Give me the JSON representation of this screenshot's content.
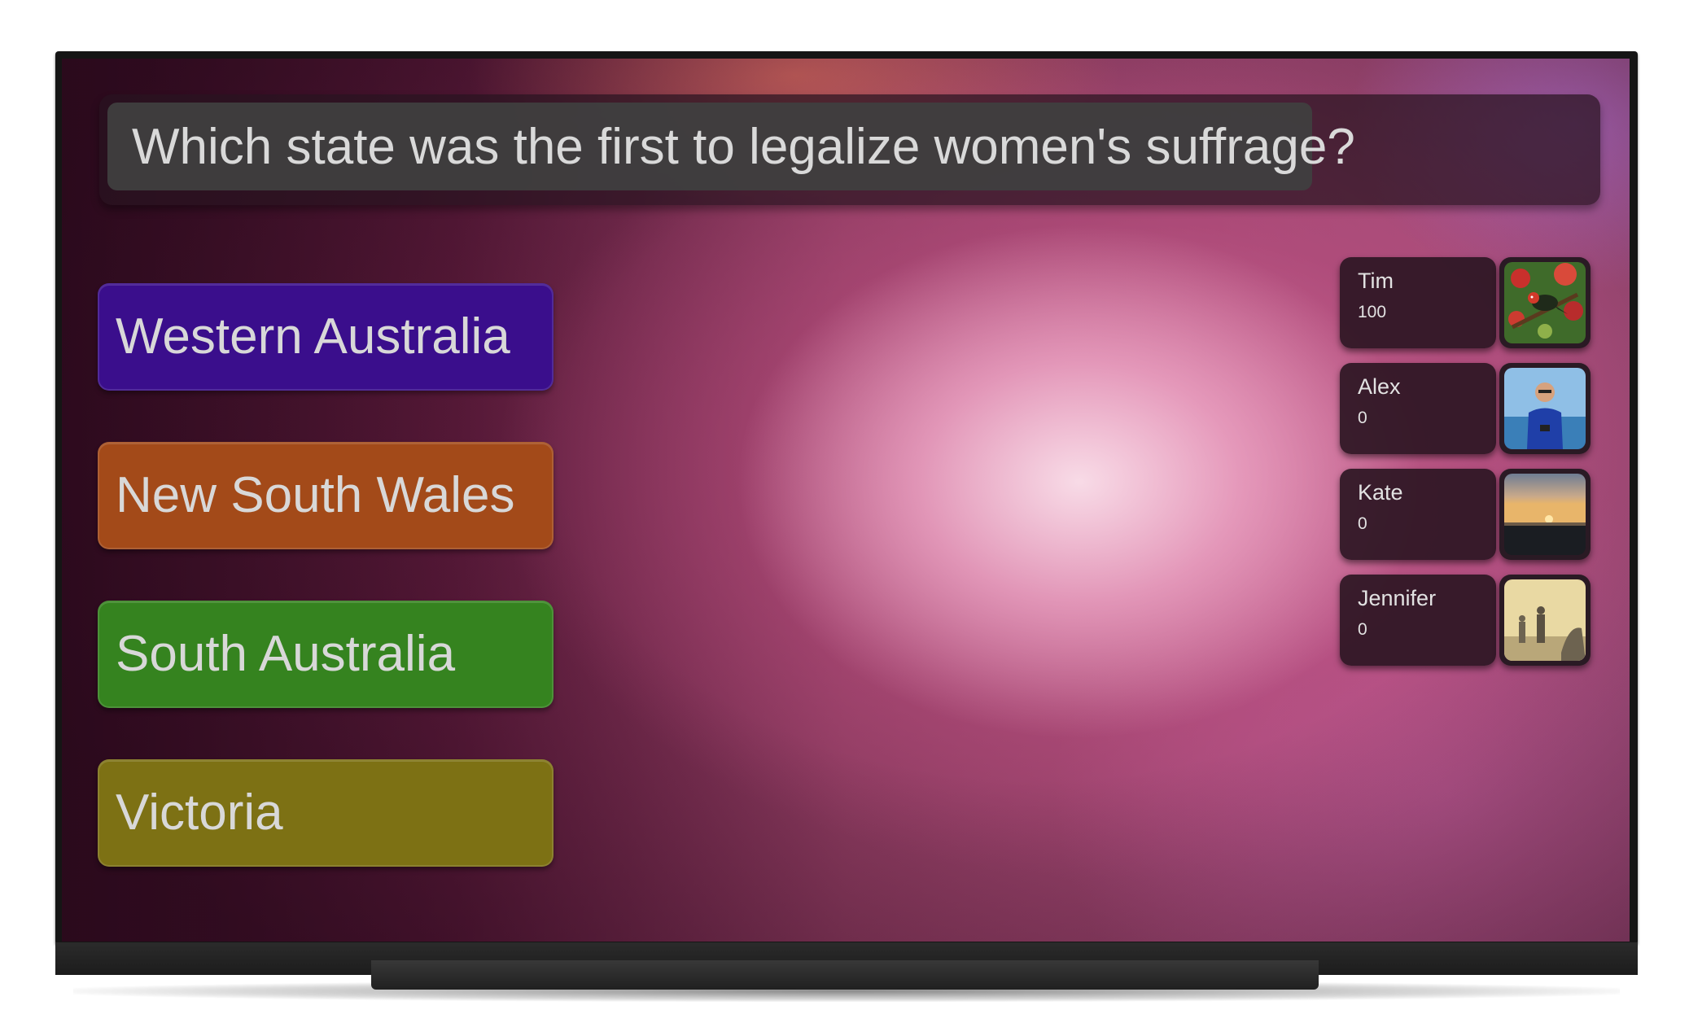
{
  "question": {
    "text": "Which state was the first to legalize women's suffrage?"
  },
  "answers": [
    {
      "label": "Western Australia",
      "color": "#3a0e8c"
    },
    {
      "label": "New South Wales",
      "color": "#a34a19"
    },
    {
      "label": "South Australia",
      "color": "#35831f"
    },
    {
      "label": "Victoria",
      "color": "#7d7114"
    }
  ],
  "players": [
    {
      "name": "Tim",
      "score": "100",
      "photo_icon": "bird-photo-icon"
    },
    {
      "name": "Alex",
      "score": "0",
      "photo_icon": "person-photo-icon"
    },
    {
      "name": "Kate",
      "score": "0",
      "photo_icon": "sunset-photo-icon"
    },
    {
      "name": "Jennifer",
      "score": "0",
      "photo_icon": "people-silhouette-photo-icon"
    }
  ]
}
